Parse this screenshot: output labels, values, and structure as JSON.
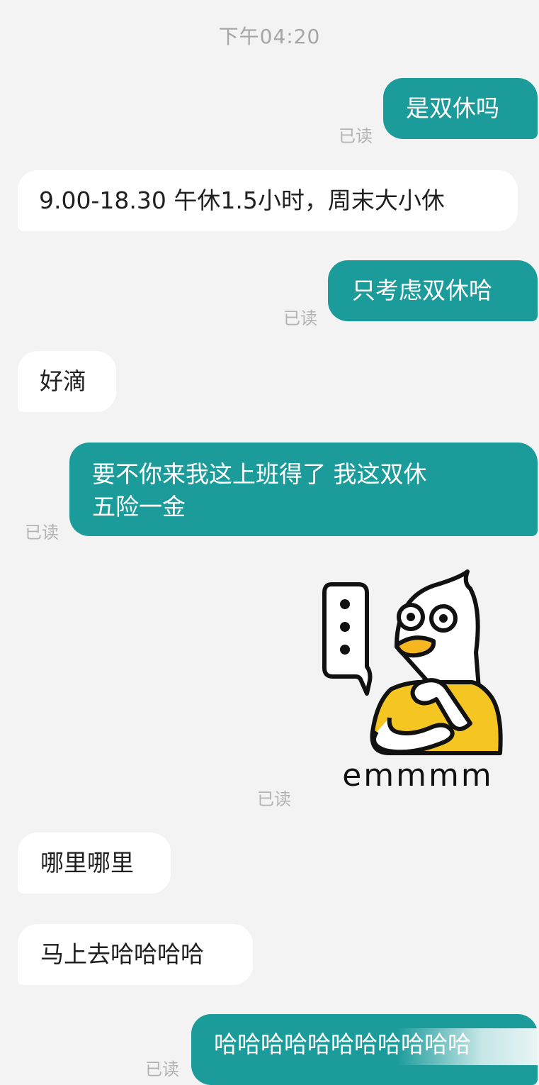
{
  "chat": {
    "timestamp": "下午04:20",
    "read_label": "已读",
    "messages": [
      {
        "side": "out",
        "text": "是双休吗"
      },
      {
        "side": "in",
        "text": "9.00-18.30 午休1.5小时，周末大小休"
      },
      {
        "side": "out",
        "text": "只考虑双休哈"
      },
      {
        "side": "in",
        "text": "好滴"
      },
      {
        "side": "out",
        "lines": [
          "要不你来我这上班得了 我这双休",
          "五险一金"
        ]
      },
      {
        "side": "out",
        "type": "sticker",
        "sticker_name": "duck-thinking-sticker",
        "caption": "emmmm"
      },
      {
        "side": "in",
        "text": "哪里哪里"
      },
      {
        "side": "in",
        "text": "马上去哈哈哈哈"
      },
      {
        "side": "out",
        "text": "哈哈哈哈哈哈哈哈哈哈哈"
      }
    ]
  },
  "colors": {
    "background": "#f3f3f3",
    "outgoing_bubble": "#1c9b9b",
    "incoming_bubble": "#ffffff",
    "sticker_shirt": "#f5c522",
    "sticker_beak": "#f5b820"
  }
}
